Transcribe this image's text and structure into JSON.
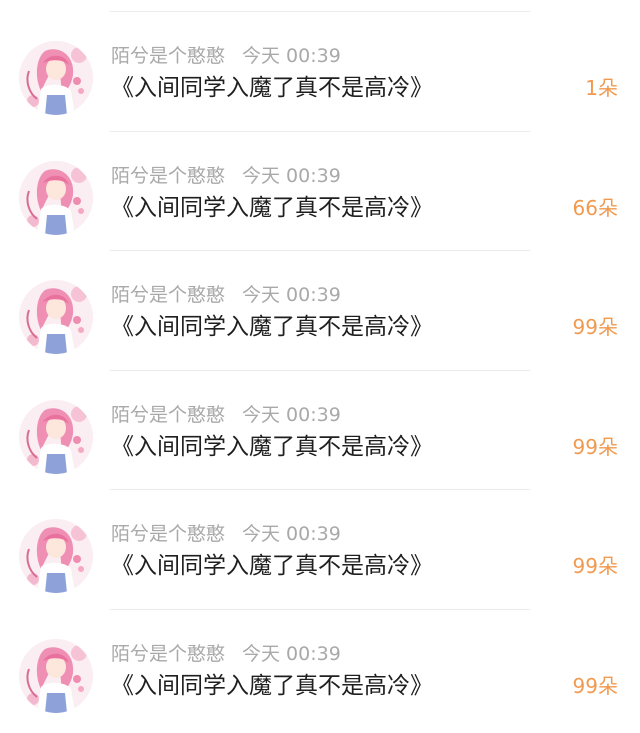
{
  "colors": {
    "background": "#ffffff",
    "username": "#a9a9a9",
    "title": "#1f1f1f",
    "gift_count": "#f19a4f",
    "divider": "#ececec"
  },
  "feed": {
    "items": [
      {
        "username": "陌兮是个憨憨",
        "time": "今天 00:39",
        "title": "《入间同学入魔了真不是高冷》",
        "gift": "1朵",
        "avatar": "pink-haired-anime-girl-avatar"
      },
      {
        "username": "陌兮是个憨憨",
        "time": "今天 00:39",
        "title": "《入间同学入魔了真不是高冷》",
        "gift": "66朵",
        "avatar": "pink-haired-anime-girl-avatar"
      },
      {
        "username": "陌兮是个憨憨",
        "time": "今天 00:39",
        "title": "《入间同学入魔了真不是高冷》",
        "gift": "99朵",
        "avatar": "pink-haired-anime-girl-avatar"
      },
      {
        "username": "陌兮是个憨憨",
        "time": "今天 00:39",
        "title": "《入间同学入魔了真不是高冷》",
        "gift": "99朵",
        "avatar": "pink-haired-anime-girl-avatar"
      },
      {
        "username": "陌兮是个憨憨",
        "time": "今天 00:39",
        "title": "《入间同学入魔了真不是高冷》",
        "gift": "99朵",
        "avatar": "pink-haired-anime-girl-avatar"
      },
      {
        "username": "陌兮是个憨憨",
        "time": "今天 00:39",
        "title": "《入间同学入魔了真不是高冷》",
        "gift": "99朵",
        "avatar": "pink-haired-anime-girl-avatar"
      }
    ]
  }
}
